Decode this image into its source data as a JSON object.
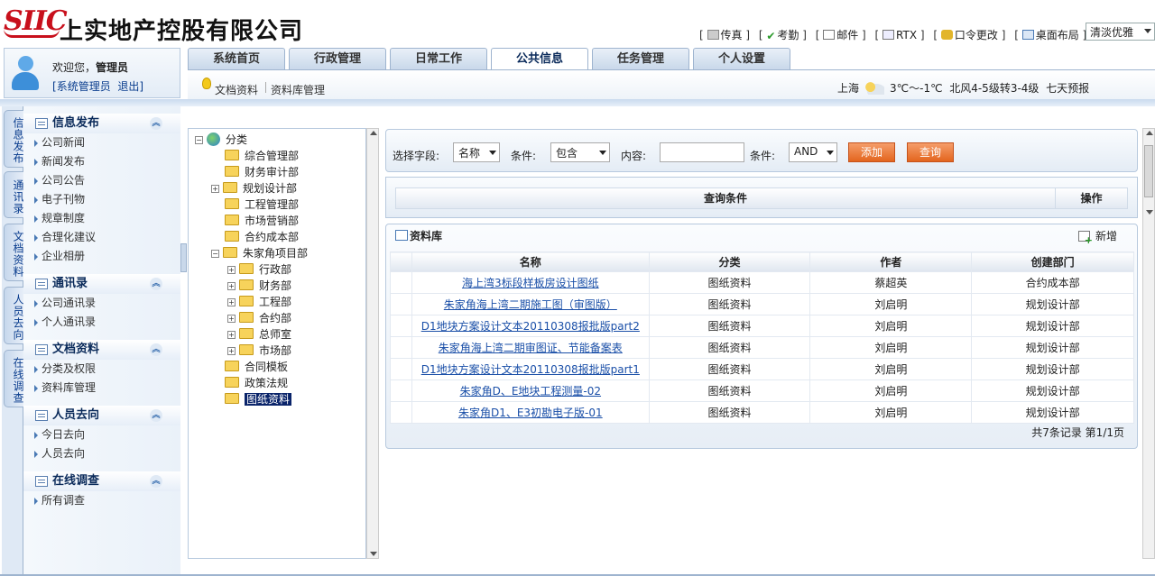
{
  "logo": {
    "mark": "SIIC",
    "company": "上实地产控股有限公司"
  },
  "toplinks": {
    "items": [
      {
        "label": "传真",
        "icon": "fax-icon"
      },
      {
        "label": "考勤",
        "icon": "checkmark-icon"
      },
      {
        "label": "邮件",
        "icon": "mail-icon"
      },
      {
        "label": "RTX",
        "icon": "rtx-icon"
      },
      {
        "label": "口令更改",
        "icon": "key-icon"
      },
      {
        "label": "桌面布局",
        "icon": "layout-icon"
      }
    ],
    "theme": "清淡优雅"
  },
  "user": {
    "greeting": "欢迎您，",
    "name": "管理员",
    "role": "系统管理员",
    "logout": "退出"
  },
  "tabs": [
    "系统首页",
    "行政管理",
    "日常工作",
    "公共信息",
    "任务管理",
    "个人设置"
  ],
  "active_tab": "公共信息",
  "subnav": {
    "item1": "文档资料",
    "item2": "资料库管理"
  },
  "weather": {
    "city": "上海",
    "temp": "3℃～-1℃",
    "wind": "北风4-5级转3-4级",
    "forecast": "七天预报"
  },
  "side_tabs": [
    "信息发布",
    "通讯录",
    "文档资料",
    "人员去向",
    "在线调查"
  ],
  "menu": [
    {
      "title": "信息发布",
      "items": [
        "公司新闻",
        "新闻发布",
        "公司公告",
        "电子刊物",
        "规章制度",
        "合理化建议",
        "企业相册"
      ]
    },
    {
      "title": "通讯录",
      "items": [
        "公司通讯录",
        "个人通讯录"
      ]
    },
    {
      "title": "文档资料",
      "items": [
        "分类及权限",
        "资料库管理"
      ]
    },
    {
      "title": "人员去向",
      "items": [
        "今日去向",
        "人员去向"
      ]
    },
    {
      "title": "在线调查",
      "items": [
        "所有调查"
      ]
    }
  ],
  "tree": {
    "root": "分类",
    "nodes": [
      "综合管理部",
      "财务审计部",
      "规划设计部",
      "工程管理部",
      "市场营销部",
      "合约成本部",
      "朱家角项目部",
      "行政部",
      "财务部",
      "工程部",
      "合约部",
      "总师室",
      "市场部",
      "合同模板",
      "政策法规",
      "图纸资料"
    ]
  },
  "query": {
    "field_label": "选择字段:",
    "field_value": "名称",
    "cond_label": "条件:",
    "cond_value": "包含",
    "content_label": "内容:",
    "content_value": "",
    "logic_label": "条件:",
    "logic_value": "AND",
    "add": "添加",
    "search": "查询"
  },
  "cond_table": {
    "col1": "查询条件",
    "col2": "操作"
  },
  "library": {
    "title": "资料库",
    "add_new": "新增",
    "columns": [
      "名称",
      "分类",
      "作者",
      "创建部门"
    ],
    "rows": [
      [
        "海上湾3标段样板房设计图纸",
        "图纸资料",
        "蔡超英",
        "合约成本部"
      ],
      [
        "朱家角海上湾二期施工图（审图版）",
        "图纸资料",
        "刘启明",
        "规划设计部"
      ],
      [
        "D1地块方案设计文本20110308报批版part2",
        "图纸资料",
        "刘启明",
        "规划设计部"
      ],
      [
        "朱家角海上湾二期审图证、节能备案表",
        "图纸资料",
        "刘启明",
        "规划设计部"
      ],
      [
        "D1地块方案设计文本20110308报批版part1",
        "图纸资料",
        "刘启明",
        "规划设计部"
      ],
      [
        "朱家角D、E地块工程测量-02",
        "图纸资料",
        "刘启明",
        "规划设计部"
      ],
      [
        "朱家角D1、E3初勘电子版-01",
        "图纸资料",
        "刘启明",
        "规划设计部"
      ]
    ],
    "paging": "共7条记录 第1/1页"
  }
}
